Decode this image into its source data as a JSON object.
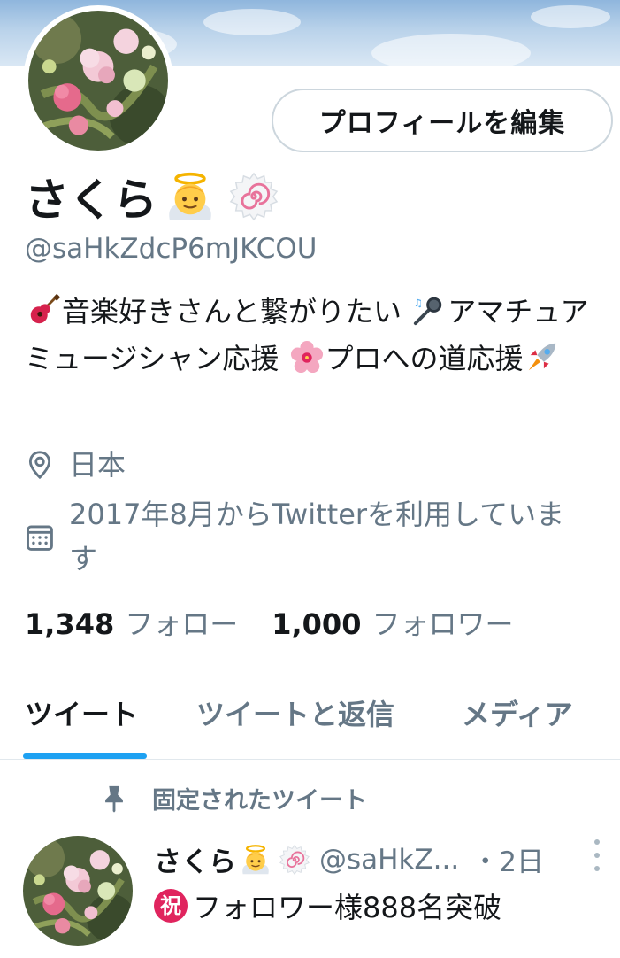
{
  "header": {
    "banner": "blue-sky-banner",
    "edit_profile_label": "プロフィールを編集"
  },
  "profile": {
    "display_name": "さくら",
    "name_emojis": [
      "angel-emoji",
      "naruto-emoji"
    ],
    "handle": "@saHkZdcP6mJKCOU",
    "bio": {
      "part1": "音楽好きさんと繋がりたい",
      "part2": "アマチュアミュージシャン応援",
      "part3": "プロへの道応援",
      "emojis": [
        "guitar-emoji",
        "microphone-emoji",
        "hibiscus-emoji",
        "rocket-emoji"
      ]
    },
    "location": "日本",
    "joined": "2017年8月からTwitterを利用しています",
    "following_count": "1,348",
    "following_label": "フォロー",
    "followers_count": "1,000",
    "followers_label": "フォロワー"
  },
  "tabs": [
    {
      "label": "ツイート",
      "active": true
    },
    {
      "label": "ツイートと返信",
      "active": false
    },
    {
      "label": "メディア",
      "active": false
    }
  ],
  "pinned_tweet": {
    "pinned_label": "固定されたツイート",
    "author_name": "さくら",
    "author_handle": "@saHkZ...",
    "time": "・2日",
    "badge_char": "祝",
    "text": "フォロワー様888名突破"
  },
  "colors": {
    "accent": "#1da1f2",
    "text": "#14171a",
    "secondary": "#657786",
    "border": "#ccd6dd",
    "badge": "#e0245e"
  },
  "icons": {
    "location": "map-pin-icon",
    "calendar": "calendar-icon",
    "pin": "pin-icon",
    "more": "more-vertical-icon"
  }
}
